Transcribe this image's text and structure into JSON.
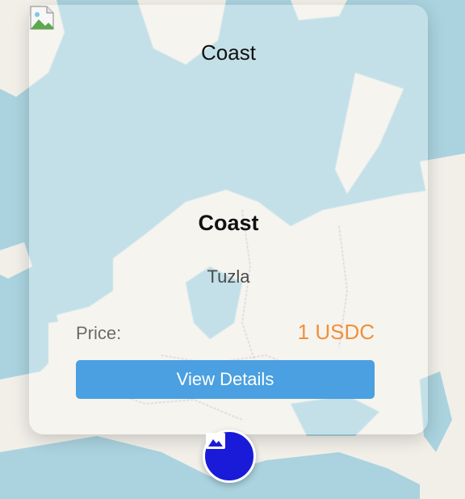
{
  "popup": {
    "header_title": "Coast",
    "title": "Coast",
    "location": "Tuzla",
    "price_label": "Price:",
    "price_value": "1 USDC",
    "details_button": "View Details",
    "close_icon": "close-icon",
    "thumbnail_icon": "broken-image-icon"
  },
  "map": {
    "marker_icon": "image-icon",
    "sea_color": "#aad3df",
    "land_color": "#f2efe9",
    "border_color": "#b9a8c0"
  },
  "colors": {
    "price": "#f0903a",
    "button": "#4aa0e0",
    "marker": "#1a1ad9"
  }
}
